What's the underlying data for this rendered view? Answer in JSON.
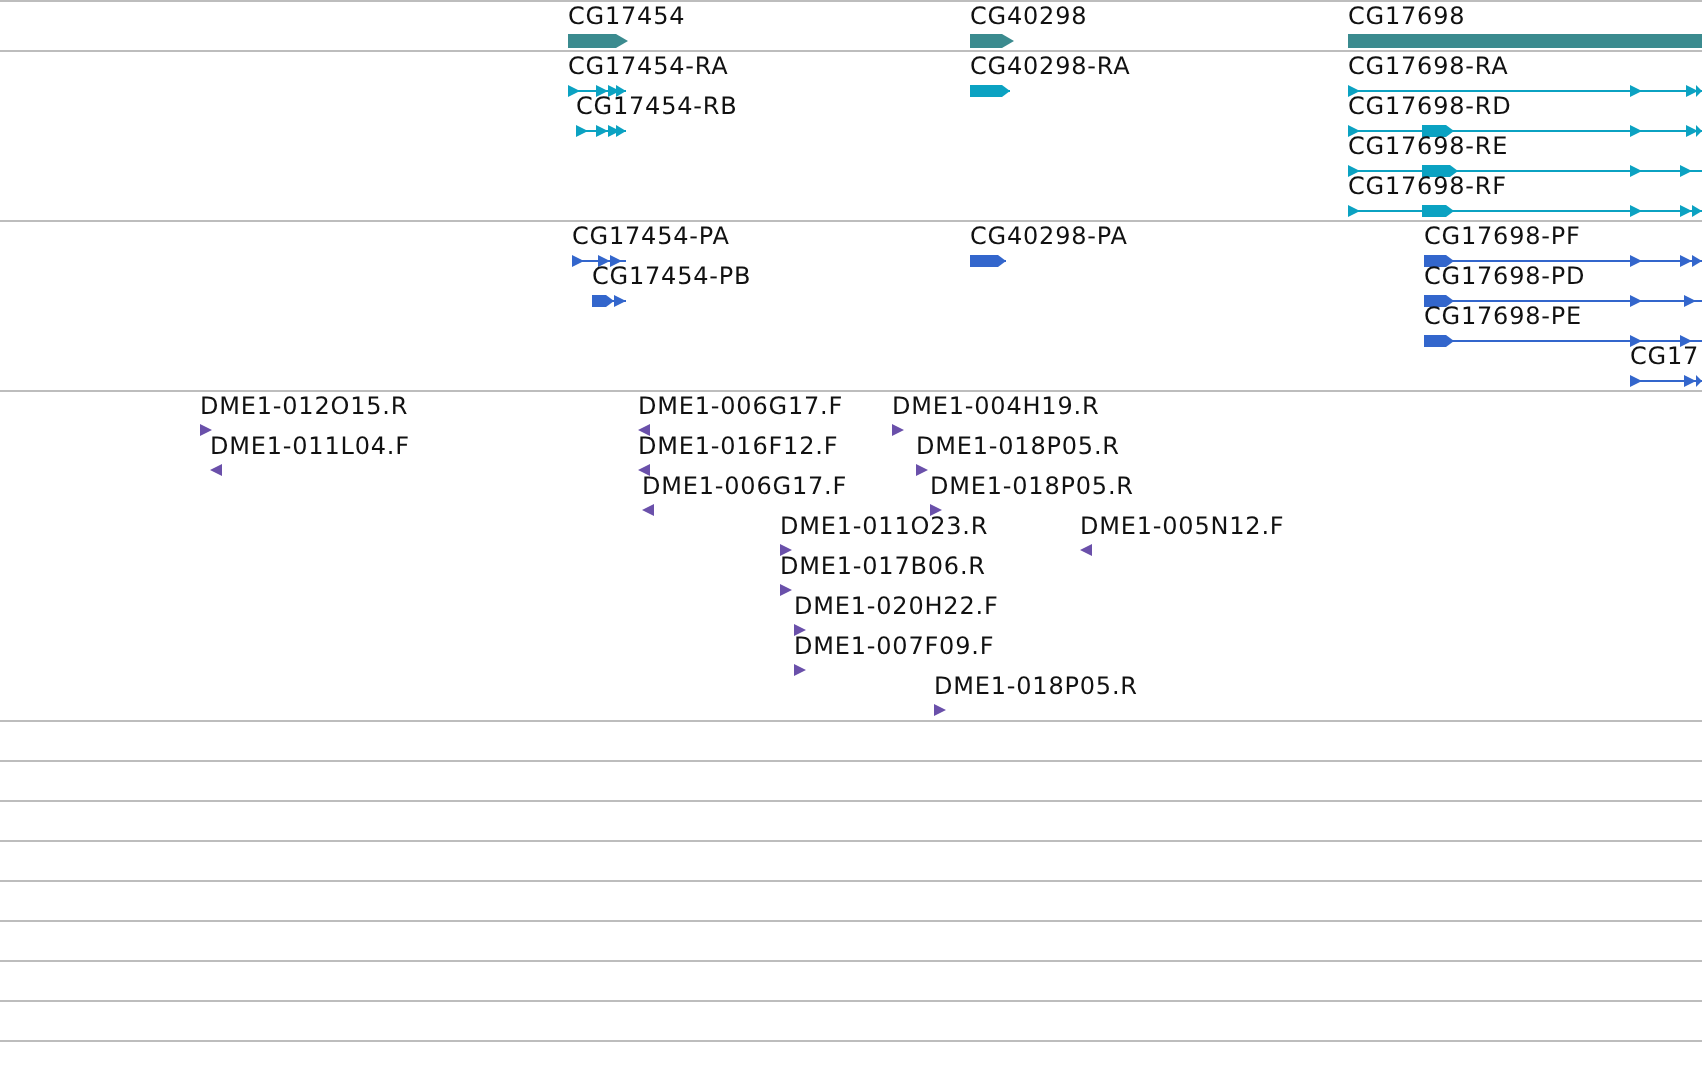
{
  "tracks": [
    {
      "kind": "gene",
      "features": [
        {
          "label": "CG17454"
        },
        {
          "label": "CG40298"
        },
        {
          "label": "CG17698"
        }
      ]
    },
    {
      "kind": "transcript",
      "features": [
        {
          "label": "CG17454-RA"
        },
        {
          "label": "CG17454-RB"
        },
        {
          "label": "CG40298-RA"
        },
        {
          "label": "CG17698-RA"
        },
        {
          "label": "CG17698-RD"
        },
        {
          "label": "CG17698-RE"
        },
        {
          "label": "CG17698-RF"
        }
      ]
    },
    {
      "kind": "protein",
      "features": [
        {
          "label": "CG17454-PA"
        },
        {
          "label": "CG17454-PB"
        },
        {
          "label": "CG40298-PA"
        },
        {
          "label": "CG17698-PF"
        },
        {
          "label": "CG17698-PD"
        },
        {
          "label": "CG17698-PE"
        },
        {
          "label": "CG17"
        }
      ]
    },
    {
      "kind": "est",
      "features": [
        {
          "label": "DME1-012O15.R",
          "reverse": false
        },
        {
          "label": "DME1-011L04.F",
          "reverse": true
        },
        {
          "label": "DME1-006G17.F",
          "reverse": true
        },
        {
          "label": "DME1-016F12.F",
          "reverse": true
        },
        {
          "label": "DME1-006G17.F",
          "reverse": true
        },
        {
          "label": "DME1-004H19.R",
          "reverse": false
        },
        {
          "label": "DME1-018P05.R",
          "reverse": false
        },
        {
          "label": "DME1-018P05.R",
          "reverse": false
        },
        {
          "label": "DME1-011O23.R",
          "reverse": false
        },
        {
          "label": "DME1-005N12.F",
          "reverse": true
        },
        {
          "label": "DME1-017B06.R",
          "reverse": false
        },
        {
          "label": "DME1-020H22.F",
          "reverse": false
        },
        {
          "label": "DME1-007F09.F",
          "reverse": false
        },
        {
          "label": "DME1-018P05.R",
          "reverse": false
        }
      ]
    }
  ]
}
